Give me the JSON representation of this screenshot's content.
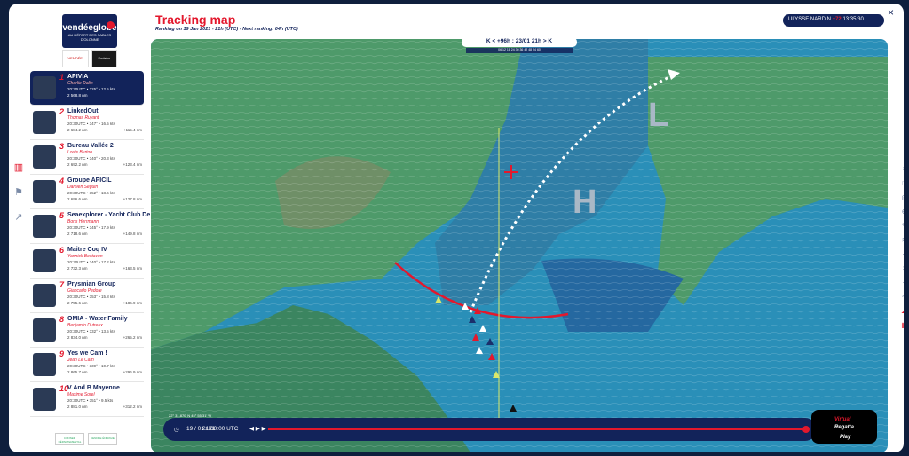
{
  "header": {
    "title": "Tracking map",
    "subtitle": "Ranking on 19 Jan 2021 - 21h (UTC)  -  Next ranking: 04h (UTC)",
    "ulysse_brand": "ULYSSE NARDIN",
    "ulysse_countdown_prefix": "+72",
    "ulysse_countdown": "13:35:30",
    "close": "×"
  },
  "logo": {
    "brand": "vendéeglobe",
    "tagline": "AU DÉPART DES SABLES D'OLONNE",
    "sponsor1": "VENDÉE",
    "sponsor2": "Sodebo"
  },
  "skippers": [
    {
      "rank": "1",
      "boat": "APIVIA",
      "skipper": "Charlie Dalin",
      "stats": "20:30UTC • 325° • 12.5 kts",
      "dist": "2 568.8 nm",
      "delta": "",
      "active": true
    },
    {
      "rank": "2",
      "boat": "LinkedOut",
      "skipper": "Thomas Ruyant",
      "stats": "20:30UTC • 347° • 16.5 kts",
      "dist": "2 684.2 nm",
      "delta": "+115.4 nm"
    },
    {
      "rank": "3",
      "boat": "Bureau Vallée 2",
      "skipper": "Louis Burton",
      "stats": "20:30UTC • 340° • 20.3 kts",
      "dist": "2 692.2 nm",
      "delta": "+123.4 nm"
    },
    {
      "rank": "4",
      "boat": "Groupe APICIL",
      "skipper": "Damien Seguin",
      "stats": "20:30UTC • 352° • 18.6 kts",
      "dist": "2 696.6 nm",
      "delta": "+127.8 nm"
    },
    {
      "rank": "5",
      "boat": "Seaexplorer - Yacht Club De Monaco",
      "skipper": "Boris Herrmann",
      "stats": "20:30UTC • 345° • 17.9 kts",
      "dist": "2 718.6 nm",
      "delta": "+149.8 nm"
    },
    {
      "rank": "6",
      "boat": "Maitre Coq IV",
      "skipper": "Yannick Bestaven",
      "stats": "20:30UTC • 340° • 17.2 kts",
      "dist": "2 732.3 nm",
      "delta": "+163.5 nm"
    },
    {
      "rank": "7",
      "boat": "Prysmian Group",
      "skipper": "Giancarlo Pedote",
      "stats": "20:30UTC • 353° • 15.8 kts",
      "dist": "2 755.6 nm",
      "delta": "+186.9 nm"
    },
    {
      "rank": "8",
      "boat": "OMIA - Water Family",
      "skipper": "Benjamin Dutreux",
      "stats": "20:30UTC • 332° • 13.5 kts",
      "dist": "2 834.0 nm",
      "delta": "+265.2 nm"
    },
    {
      "rank": "9",
      "boat": "Yes we Cam !",
      "skipper": "Jean Le Cam",
      "stats": "20:30UTC • 339° • 10.7 kts",
      "dist": "2 865.7 nm",
      "delta": "+296.9 nm"
    },
    {
      "rank": "10",
      "boat": "V And B Mayenne",
      "skipper": "Maxime Sorel",
      "stats": "20:30UTC • 351° • 9.5 kts",
      "dist": "2 881.0 nm",
      "delta": "+312.2 nm"
    }
  ],
  "map": {
    "forecast": "+96h : 23/01 21h",
    "scale": "06 12 18 24 30 36 42 48 54 60",
    "coords": "22° 31.870' N 45° 55.31' W",
    "high": "H",
    "low": "L"
  },
  "player": {
    "date": "19 / 01 / 21",
    "time": "21:00:00 UTC",
    "progress": 1.0
  },
  "virtual_regatta": {
    "line1": "Virtual",
    "line2": "Regatta",
    "play": "Play"
  },
  "footer": {
    "logo1": "CONSEIL DÉPARTEMENTAL",
    "logo2": "VENDÉE ÉNERGIE"
  },
  "colors": {
    "navy": "#12235a",
    "red": "#e3182d",
    "ocean": "#2a8fb8",
    "land": "#4e9a6a"
  }
}
